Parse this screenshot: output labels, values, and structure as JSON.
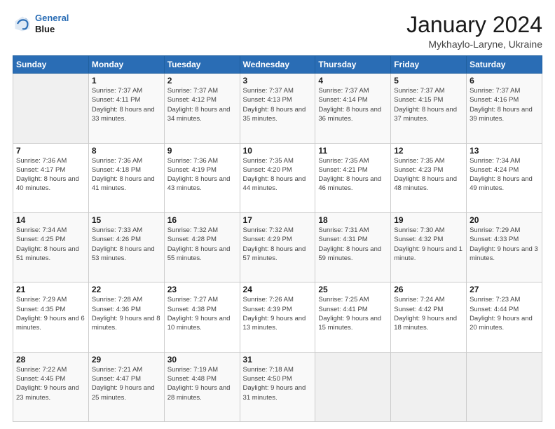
{
  "logo": {
    "line1": "General",
    "line2": "Blue"
  },
  "title": "January 2024",
  "subtitle": "Mykhaylo-Laryne, Ukraine",
  "weekdays": [
    "Sunday",
    "Monday",
    "Tuesday",
    "Wednesday",
    "Thursday",
    "Friday",
    "Saturday"
  ],
  "weeks": [
    [
      {
        "day": "",
        "sunrise": "",
        "sunset": "",
        "daylight": ""
      },
      {
        "day": "1",
        "sunrise": "Sunrise: 7:37 AM",
        "sunset": "Sunset: 4:11 PM",
        "daylight": "Daylight: 8 hours and 33 minutes."
      },
      {
        "day": "2",
        "sunrise": "Sunrise: 7:37 AM",
        "sunset": "Sunset: 4:12 PM",
        "daylight": "Daylight: 8 hours and 34 minutes."
      },
      {
        "day": "3",
        "sunrise": "Sunrise: 7:37 AM",
        "sunset": "Sunset: 4:13 PM",
        "daylight": "Daylight: 8 hours and 35 minutes."
      },
      {
        "day": "4",
        "sunrise": "Sunrise: 7:37 AM",
        "sunset": "Sunset: 4:14 PM",
        "daylight": "Daylight: 8 hours and 36 minutes."
      },
      {
        "day": "5",
        "sunrise": "Sunrise: 7:37 AM",
        "sunset": "Sunset: 4:15 PM",
        "daylight": "Daylight: 8 hours and 37 minutes."
      },
      {
        "day": "6",
        "sunrise": "Sunrise: 7:37 AM",
        "sunset": "Sunset: 4:16 PM",
        "daylight": "Daylight: 8 hours and 39 minutes."
      }
    ],
    [
      {
        "day": "7",
        "sunrise": "Sunrise: 7:36 AM",
        "sunset": "Sunset: 4:17 PM",
        "daylight": "Daylight: 8 hours and 40 minutes."
      },
      {
        "day": "8",
        "sunrise": "Sunrise: 7:36 AM",
        "sunset": "Sunset: 4:18 PM",
        "daylight": "Daylight: 8 hours and 41 minutes."
      },
      {
        "day": "9",
        "sunrise": "Sunrise: 7:36 AM",
        "sunset": "Sunset: 4:19 PM",
        "daylight": "Daylight: 8 hours and 43 minutes."
      },
      {
        "day": "10",
        "sunrise": "Sunrise: 7:35 AM",
        "sunset": "Sunset: 4:20 PM",
        "daylight": "Daylight: 8 hours and 44 minutes."
      },
      {
        "day": "11",
        "sunrise": "Sunrise: 7:35 AM",
        "sunset": "Sunset: 4:21 PM",
        "daylight": "Daylight: 8 hours and 46 minutes."
      },
      {
        "day": "12",
        "sunrise": "Sunrise: 7:35 AM",
        "sunset": "Sunset: 4:23 PM",
        "daylight": "Daylight: 8 hours and 48 minutes."
      },
      {
        "day": "13",
        "sunrise": "Sunrise: 7:34 AM",
        "sunset": "Sunset: 4:24 PM",
        "daylight": "Daylight: 8 hours and 49 minutes."
      }
    ],
    [
      {
        "day": "14",
        "sunrise": "Sunrise: 7:34 AM",
        "sunset": "Sunset: 4:25 PM",
        "daylight": "Daylight: 8 hours and 51 minutes."
      },
      {
        "day": "15",
        "sunrise": "Sunrise: 7:33 AM",
        "sunset": "Sunset: 4:26 PM",
        "daylight": "Daylight: 8 hours and 53 minutes."
      },
      {
        "day": "16",
        "sunrise": "Sunrise: 7:32 AM",
        "sunset": "Sunset: 4:28 PM",
        "daylight": "Daylight: 8 hours and 55 minutes."
      },
      {
        "day": "17",
        "sunrise": "Sunrise: 7:32 AM",
        "sunset": "Sunset: 4:29 PM",
        "daylight": "Daylight: 8 hours and 57 minutes."
      },
      {
        "day": "18",
        "sunrise": "Sunrise: 7:31 AM",
        "sunset": "Sunset: 4:31 PM",
        "daylight": "Daylight: 8 hours and 59 minutes."
      },
      {
        "day": "19",
        "sunrise": "Sunrise: 7:30 AM",
        "sunset": "Sunset: 4:32 PM",
        "daylight": "Daylight: 9 hours and 1 minute."
      },
      {
        "day": "20",
        "sunrise": "Sunrise: 7:29 AM",
        "sunset": "Sunset: 4:33 PM",
        "daylight": "Daylight: 9 hours and 3 minutes."
      }
    ],
    [
      {
        "day": "21",
        "sunrise": "Sunrise: 7:29 AM",
        "sunset": "Sunset: 4:35 PM",
        "daylight": "Daylight: 9 hours and 6 minutes."
      },
      {
        "day": "22",
        "sunrise": "Sunrise: 7:28 AM",
        "sunset": "Sunset: 4:36 PM",
        "daylight": "Daylight: 9 hours and 8 minutes."
      },
      {
        "day": "23",
        "sunrise": "Sunrise: 7:27 AM",
        "sunset": "Sunset: 4:38 PM",
        "daylight": "Daylight: 9 hours and 10 minutes."
      },
      {
        "day": "24",
        "sunrise": "Sunrise: 7:26 AM",
        "sunset": "Sunset: 4:39 PM",
        "daylight": "Daylight: 9 hours and 13 minutes."
      },
      {
        "day": "25",
        "sunrise": "Sunrise: 7:25 AM",
        "sunset": "Sunset: 4:41 PM",
        "daylight": "Daylight: 9 hours and 15 minutes."
      },
      {
        "day": "26",
        "sunrise": "Sunrise: 7:24 AM",
        "sunset": "Sunset: 4:42 PM",
        "daylight": "Daylight: 9 hours and 18 minutes."
      },
      {
        "day": "27",
        "sunrise": "Sunrise: 7:23 AM",
        "sunset": "Sunset: 4:44 PM",
        "daylight": "Daylight: 9 hours and 20 minutes."
      }
    ],
    [
      {
        "day": "28",
        "sunrise": "Sunrise: 7:22 AM",
        "sunset": "Sunset: 4:45 PM",
        "daylight": "Daylight: 9 hours and 23 minutes."
      },
      {
        "day": "29",
        "sunrise": "Sunrise: 7:21 AM",
        "sunset": "Sunset: 4:47 PM",
        "daylight": "Daylight: 9 hours and 25 minutes."
      },
      {
        "day": "30",
        "sunrise": "Sunrise: 7:19 AM",
        "sunset": "Sunset: 4:48 PM",
        "daylight": "Daylight: 9 hours and 28 minutes."
      },
      {
        "day": "31",
        "sunrise": "Sunrise: 7:18 AM",
        "sunset": "Sunset: 4:50 PM",
        "daylight": "Daylight: 9 hours and 31 minutes."
      },
      {
        "day": "",
        "sunrise": "",
        "sunset": "",
        "daylight": ""
      },
      {
        "day": "",
        "sunrise": "",
        "sunset": "",
        "daylight": ""
      },
      {
        "day": "",
        "sunrise": "",
        "sunset": "",
        "daylight": ""
      }
    ]
  ]
}
